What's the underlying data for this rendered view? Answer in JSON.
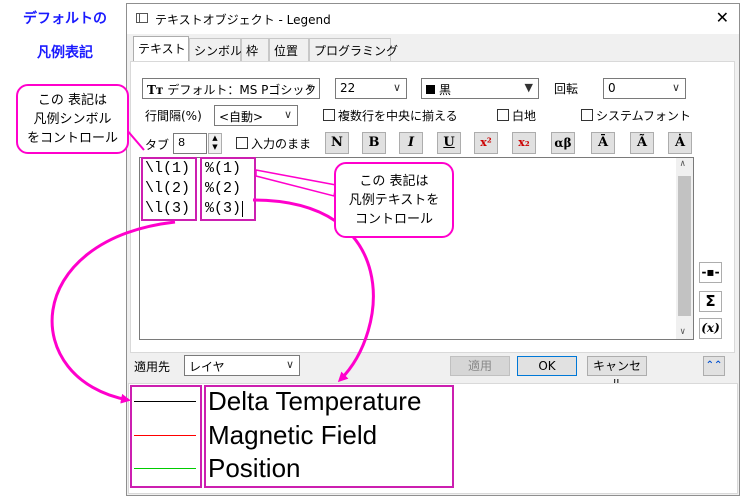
{
  "side_title": {
    "line1": "デフォルトの",
    "line2": "凡例表記"
  },
  "window": {
    "title": "テキストオブジェクト - Legend",
    "close": "✕"
  },
  "tabs": [
    {
      "label": "テキスト"
    },
    {
      "label": "シンボル"
    },
    {
      "label": "枠"
    },
    {
      "label": "位置"
    },
    {
      "label": "プログラミング"
    }
  ],
  "toolbar": {
    "font_icon": "Tт",
    "font_value": "デフォルト：MS Pゴシック",
    "size_value": "22",
    "color_value": "黒",
    "rotate_label": "回転",
    "rotate_value": "0",
    "line_spacing_label": "行間隔(%)",
    "line_spacing_value": "<自動>",
    "center_multi_label": "複数行を中央に揃える",
    "white_bg_label": "白地",
    "system_font_label": "システムフォント",
    "tab_label": "タブ",
    "tab_value": "8",
    "raw_input_label": "入力のまま"
  },
  "format_buttons": [
    "N",
    "B",
    "I",
    "U",
    "x²",
    "x₂",
    "αβ",
    "Ā",
    "Ã",
    "Ȧ"
  ],
  "editor": {
    "lines": [
      {
        "symbol": "\\l(1)",
        "text": "%(1)"
      },
      {
        "symbol": "\\l(2)",
        "text": "%(2)"
      },
      {
        "symbol": "\\l(3)",
        "text": "%(3)"
      }
    ]
  },
  "side_buttons": {
    "b1": "-▪-",
    "b2": "Σ",
    "b3": "(x)"
  },
  "bottom": {
    "apply_to_label": "適用先",
    "apply_to_value": "レイヤ",
    "apply_button": "適用",
    "ok_button": "OK",
    "cancel_button": "キャンセル",
    "collapse_button": "⌃⌃"
  },
  "preview": {
    "entries": [
      {
        "text": "Delta Temperature",
        "color": "#000000"
      },
      {
        "text": "Magnetic Field",
        "color": "#ff0000"
      },
      {
        "text": "Position",
        "color": "#00cc00"
      }
    ]
  },
  "callouts": {
    "symbol": {
      "line1": "この 表記は",
      "line2": "凡例シンボル",
      "line3": "をコントロール"
    },
    "text": {
      "line1": "この 表記は",
      "line2": "凡例テキストを",
      "line3": "コントロール"
    }
  },
  "colors": {
    "annotation": "#ff00cc",
    "title": "#1a1aff"
  }
}
